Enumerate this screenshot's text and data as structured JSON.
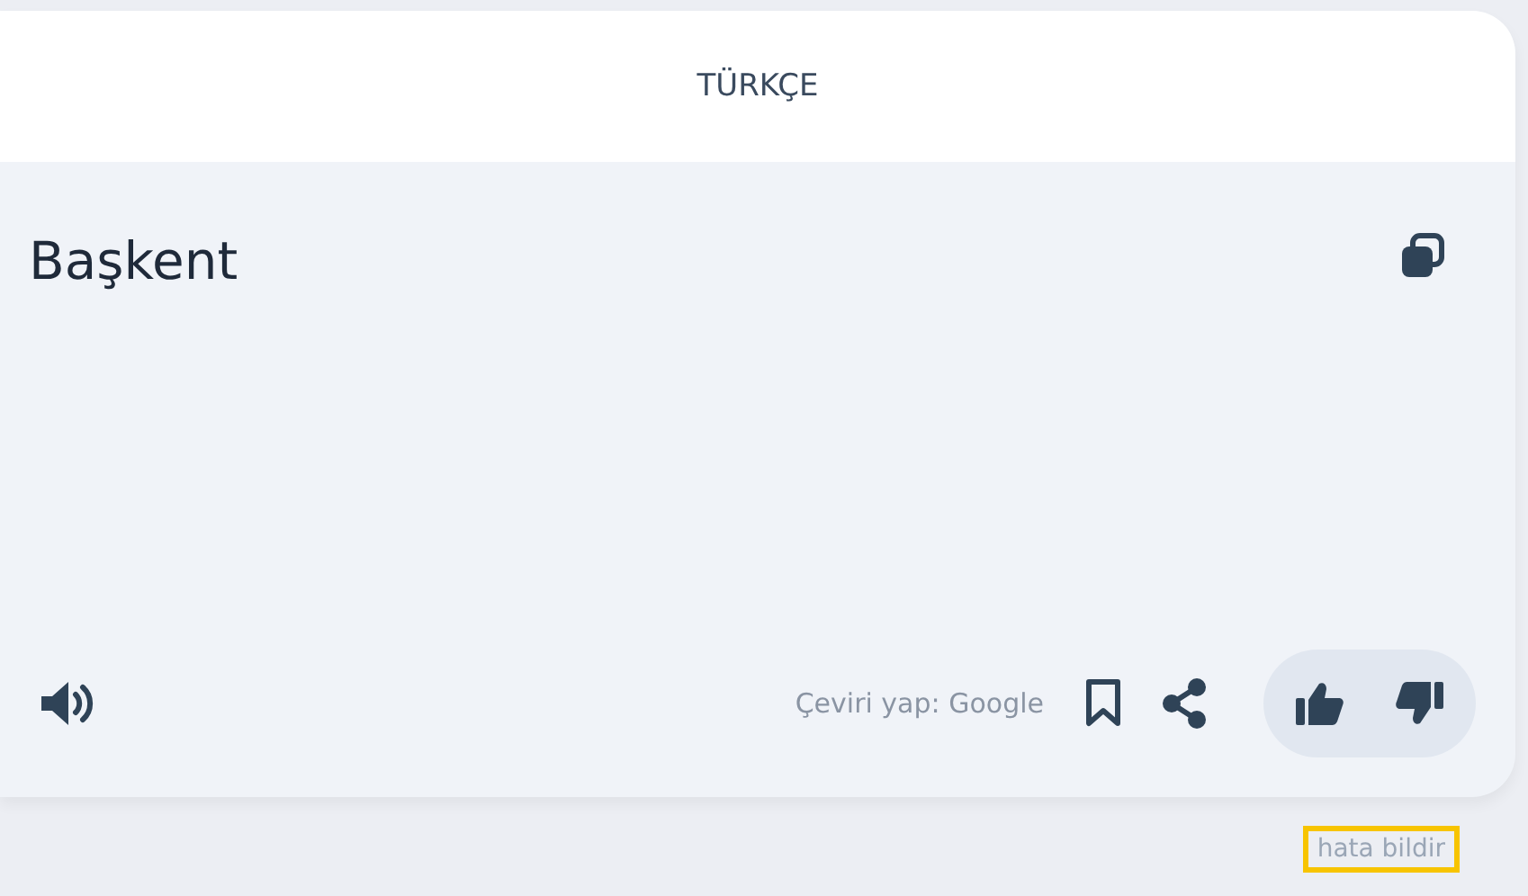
{
  "header": {
    "language": "TÜRKÇE"
  },
  "translation": {
    "text": "Başkent"
  },
  "toolbar": {
    "credit": "Çeviri yap: Google"
  },
  "report_link": "hata bildir"
}
